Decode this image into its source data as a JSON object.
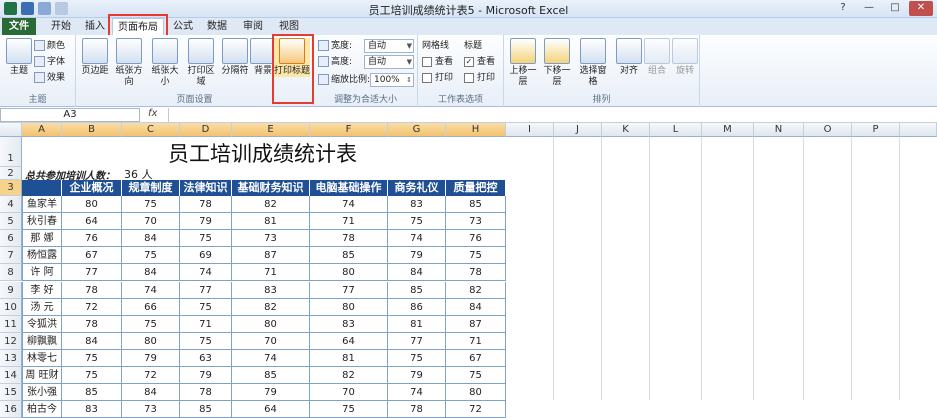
{
  "window": {
    "title": "员工培训成绩统计表5 - Microsoft Excel",
    "controls": [
      "?",
      "—",
      "□",
      "✕"
    ]
  },
  "tabs": [
    {
      "label": "文件"
    },
    {
      "label": "开始"
    },
    {
      "label": "插入"
    },
    {
      "label": "页面布局"
    },
    {
      "label": "公式"
    },
    {
      "label": "数据"
    },
    {
      "label": "审阅"
    },
    {
      "label": "视图"
    }
  ],
  "ribbon": {
    "theme": {
      "label": "主题",
      "big": "主题",
      "colors": "颜色",
      "fonts": "字体",
      "effects": "效果"
    },
    "page_setup": {
      "label": "页面设置",
      "buttons": [
        "页边距",
        "纸张方向",
        "纸张大小",
        "打印区域",
        "分隔符",
        "背景",
        "打印标题"
      ]
    },
    "scale": {
      "label": "调整为合适大小",
      "width_label": "宽度:",
      "width_value": "自动",
      "height_label": "高度:",
      "height_value": "自动",
      "scale_label": "缩放比例:",
      "scale_value": "100%"
    },
    "sheet_options": {
      "label": "工作表选项",
      "gridlines": "网格线",
      "headings": "标题",
      "view": "查看",
      "print": "打印"
    },
    "arrange": {
      "label": "排列",
      "buttons": [
        "上移一层",
        "下移一层",
        "选择窗格",
        "对齐",
        "组合",
        "旋转"
      ]
    }
  },
  "formula_bar": {
    "name_box": "A3",
    "fx": "fx",
    "formula": ""
  },
  "columns": [
    "A",
    "B",
    "C",
    "D",
    "E",
    "F",
    "G",
    "H",
    "I",
    "J",
    "K",
    "L",
    "M",
    "N",
    "O",
    "P"
  ],
  "rows": [
    "1",
    "2",
    "3",
    "4",
    "5",
    "6",
    "7",
    "8",
    "9",
    "10",
    "11",
    "12",
    "13",
    "14",
    "15",
    "16"
  ],
  "sheet": {
    "title": "员工培训成绩统计表",
    "count_label": "总共参加培训人数：",
    "count_value": "36 人",
    "headers": [
      "",
      "企业概况",
      "规章制度",
      "法律知识",
      "基础财务知识",
      "电脑基础操作",
      "商务礼仪",
      "质量把控"
    ],
    "data": [
      [
        "鱼家羊",
        "80",
        "75",
        "78",
        "82",
        "74",
        "83",
        "85"
      ],
      [
        "秋引春",
        "64",
        "70",
        "79",
        "81",
        "71",
        "75",
        "73"
      ],
      [
        "那  娜",
        "76",
        "84",
        "75",
        "73",
        "78",
        "74",
        "76"
      ],
      [
        "杨恒露",
        "67",
        "75",
        "69",
        "87",
        "85",
        "79",
        "75"
      ],
      [
        "许  阿",
        "77",
        "84",
        "74",
        "71",
        "80",
        "84",
        "78"
      ],
      [
        "李  好",
        "78",
        "74",
        "77",
        "83",
        "77",
        "85",
        "82"
      ],
      [
        "汤  元",
        "72",
        "66",
        "75",
        "82",
        "80",
        "86",
        "84"
      ],
      [
        "令狐洪",
        "78",
        "75",
        "71",
        "80",
        "83",
        "81",
        "87"
      ],
      [
        "柳飘飘",
        "84",
        "80",
        "75",
        "70",
        "64",
        "77",
        "71"
      ],
      [
        "林零七",
        "75",
        "79",
        "63",
        "74",
        "81",
        "75",
        "67"
      ],
      [
        "周  旺财",
        "75",
        "72",
        "79",
        "85",
        "82",
        "79",
        "75"
      ],
      [
        "张小强",
        "85",
        "84",
        "78",
        "79",
        "70",
        "74",
        "80"
      ],
      [
        "柏古今",
        "83",
        "73",
        "85",
        "64",
        "75",
        "78",
        "72"
      ]
    ]
  },
  "colors": {
    "header_fill": "#1f4f94",
    "file_tab": "#2a6a37",
    "highlight": "#e53b30"
  }
}
